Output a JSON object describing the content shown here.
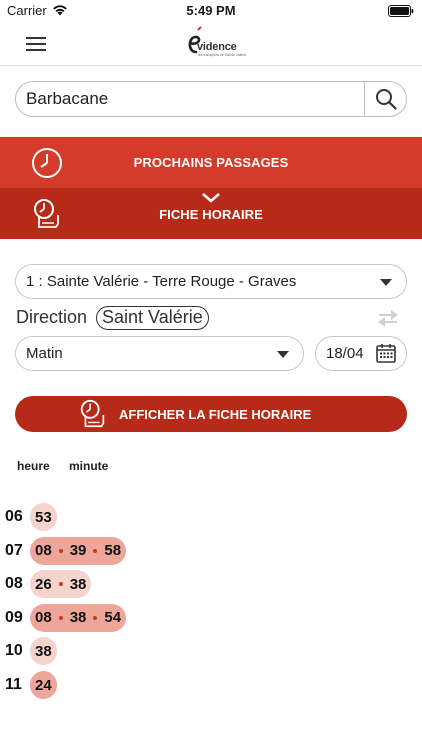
{
  "status_bar": {
    "carrier": "Carrier",
    "time": "5:49 PM"
  },
  "header": {
    "logo_text": "vidence",
    "logo_subtext": "les transports de Sainte Valérie"
  },
  "search": {
    "value": "Barbacane",
    "icon": "search-icon"
  },
  "tabs": [
    {
      "label": "PROCHAINS PASSAGES",
      "icon": "clock-icon"
    },
    {
      "label": "FICHE HORAIRE",
      "icon": "timetable-clock-icon",
      "active": true
    }
  ],
  "form": {
    "line_value": "1 : Sainte Valérie - Terre Rouge - Graves",
    "direction_label": "Direction",
    "direction_value": "Saint Valérie",
    "period_value": "Matin",
    "date_value": "18/04"
  },
  "show_button": {
    "label": "AFFICHER LA FICHE HORAIRE"
  },
  "timetable": {
    "col_heure": "heure",
    "col_minute": "minute",
    "rows": [
      {
        "hour": "06",
        "minutes": [
          "53"
        ]
      },
      {
        "hour": "07",
        "minutes": [
          "08",
          "39",
          "58"
        ]
      },
      {
        "hour": "08",
        "minutes": [
          "26",
          "38"
        ]
      },
      {
        "hour": "09",
        "minutes": [
          "08",
          "38",
          "54"
        ]
      },
      {
        "hour": "10",
        "minutes": [
          "38"
        ]
      },
      {
        "hour": "11",
        "minutes": [
          "24"
        ]
      }
    ]
  },
  "colors": {
    "accent": "#d53b2a",
    "accent_dark": "#b72a18",
    "pill_light": "#f6d3cd",
    "pill_dark": "#eea69b"
  }
}
